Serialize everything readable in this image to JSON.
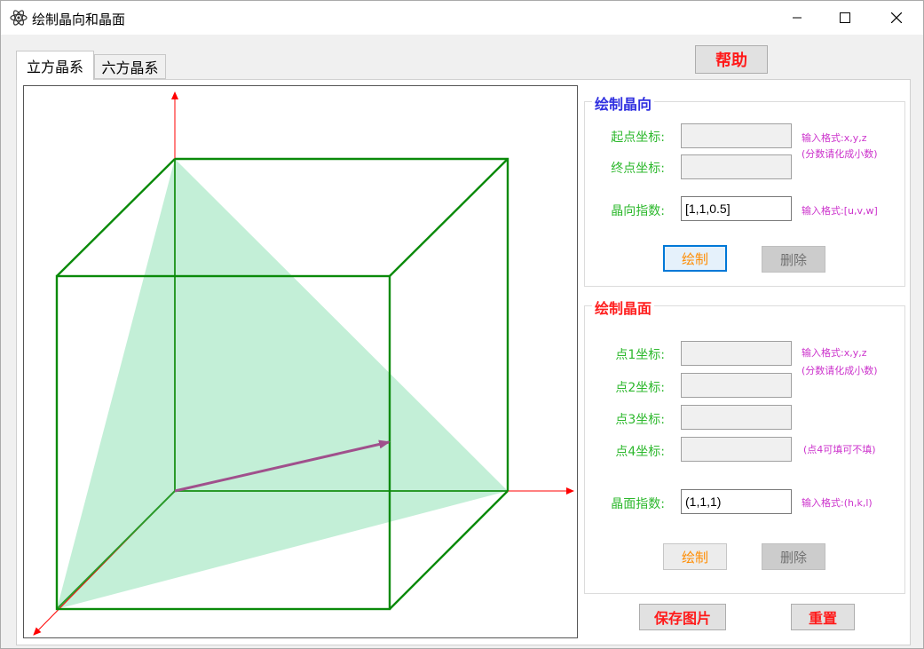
{
  "window": {
    "title": "绘制晶向和晶面",
    "icon": "atom-icon",
    "controls": [
      "minimize-icon",
      "maximize-icon",
      "close-icon"
    ]
  },
  "tabs": [
    {
      "label": "立方晶系",
      "active": true
    },
    {
      "label": "六方晶系",
      "active": false
    }
  ],
  "help_button": "帮助",
  "direction_group": {
    "title": "绘制晶向",
    "start_label": "起点坐标:",
    "start_value": "",
    "end_label": "终点坐标:",
    "end_value": "",
    "coord_hint_1": "输入格式:x,y,z",
    "coord_hint_2": "(分数请化成小数)",
    "index_label": "晶向指数:",
    "index_value": "[1,1,0.5]",
    "index_hint": "输入格式:[u,v,w]",
    "draw_button": "绘制",
    "delete_button": "删除"
  },
  "plane_group": {
    "title": "绘制晶面",
    "p1_label": "点1坐标:",
    "p1_value": "",
    "p2_label": "点2坐标:",
    "p2_value": "",
    "p3_label": "点3坐标:",
    "p3_value": "",
    "p4_label": "点4坐标:",
    "p4_value": "",
    "coord_hint_1": "输入格式:x,y,z",
    "coord_hint_2": "(分数请化成小数)",
    "p4_hint": "(点4可填可不填)",
    "index_label": "晶面指数:",
    "index_value": "(1,1,1)",
    "index_hint": "输入格式:(h,k,l)",
    "draw_button": "绘制",
    "delete_button": "删除"
  },
  "save_button": "保存图片",
  "reset_button": "重置",
  "colors": {
    "cube_edges": "#0a8a0a",
    "plane_fill": "#b8ecd0",
    "direction_arrow": "#a0508c",
    "axes": "#ff0000"
  }
}
